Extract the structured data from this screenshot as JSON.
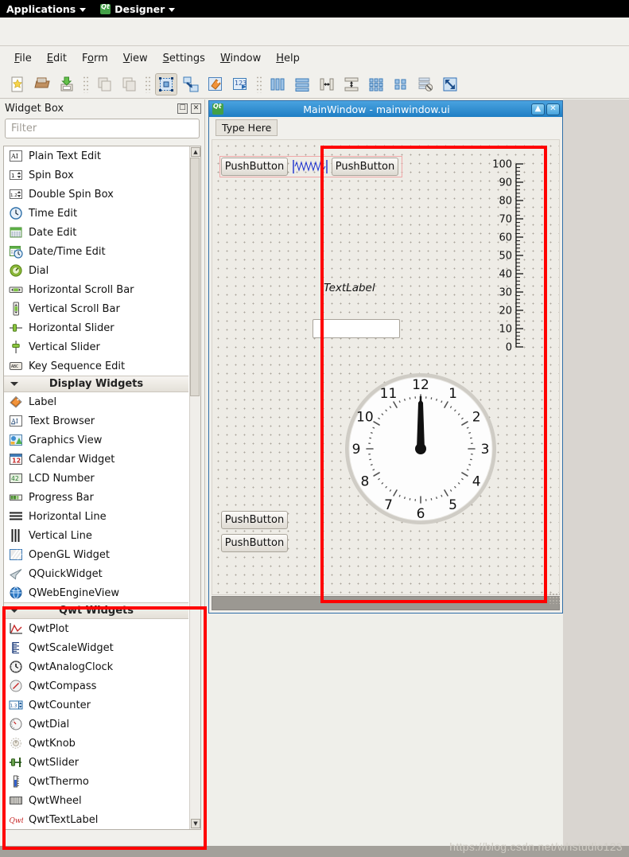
{
  "desktop": {
    "applications_label": "Applications",
    "app_label": "Designer",
    "qt_icon": "qt-logo-icon"
  },
  "menubar": {
    "items": [
      {
        "label": "File",
        "mnemonic": "F"
      },
      {
        "label": "Edit",
        "mnemonic": "E"
      },
      {
        "label": "Form",
        "mnemonic": "o"
      },
      {
        "label": "View",
        "mnemonic": "V"
      },
      {
        "label": "Settings",
        "mnemonic": "S"
      },
      {
        "label": "Window",
        "mnemonic": "W"
      },
      {
        "label": "Help",
        "mnemonic": "H"
      }
    ]
  },
  "toolbar": {
    "buttons": [
      {
        "name": "new-form-icon",
        "tip": "New"
      },
      {
        "name": "open-form-icon",
        "tip": "Open"
      },
      {
        "name": "save-form-icon",
        "tip": "Save"
      },
      {
        "name": "copy-icon",
        "tip": "Copy"
      },
      {
        "name": "paste-icon",
        "tip": "Paste"
      },
      {
        "name": "edit-widgets-icon",
        "tip": "Edit Widgets",
        "active": true
      },
      {
        "name": "edit-signals-slots-icon",
        "tip": "Edit Signals/Slots"
      },
      {
        "name": "edit-buddies-icon",
        "tip": "Edit Buddies"
      },
      {
        "name": "edit-tab-order-icon",
        "tip": "Edit Tab Order"
      },
      {
        "name": "layout-horizontally-icon",
        "tip": "Lay Out Horizontally"
      },
      {
        "name": "layout-vertically-icon",
        "tip": "Lay Out Vertically"
      },
      {
        "name": "layout-splitter-horizontal-icon",
        "tip": "Lay Out Horizontally in Splitter"
      },
      {
        "name": "layout-splitter-vertical-icon",
        "tip": "Lay Out Vertically in Splitter"
      },
      {
        "name": "layout-grid-icon",
        "tip": "Lay Out in a Grid"
      },
      {
        "name": "layout-form-icon",
        "tip": "Lay Out in a Form Layout"
      },
      {
        "name": "break-layout-icon",
        "tip": "Break Layout"
      },
      {
        "name": "adjust-size-icon",
        "tip": "Adjust Size"
      }
    ]
  },
  "widget_box": {
    "title": "Widget Box",
    "float_button": "float-icon",
    "close_button": "close-icon",
    "filter_placeholder": "Filter",
    "rows": [
      {
        "type": "item",
        "label": "Plain Text Edit",
        "icon": "plain-text-edit-icon"
      },
      {
        "type": "item",
        "label": "Spin Box",
        "icon": "spin-box-icon"
      },
      {
        "type": "item",
        "label": "Double Spin Box",
        "icon": "double-spin-box-icon"
      },
      {
        "type": "item",
        "label": "Time Edit",
        "icon": "time-edit-icon"
      },
      {
        "type": "item",
        "label": "Date Edit",
        "icon": "date-edit-icon"
      },
      {
        "type": "item",
        "label": "Date/Time Edit",
        "icon": "date-time-edit-icon"
      },
      {
        "type": "item",
        "label": "Dial",
        "icon": "dial-icon"
      },
      {
        "type": "item",
        "label": "Horizontal Scroll Bar",
        "icon": "horizontal-scroll-bar-icon"
      },
      {
        "type": "item",
        "label": "Vertical Scroll Bar",
        "icon": "vertical-scroll-bar-icon"
      },
      {
        "type": "item",
        "label": "Horizontal Slider",
        "icon": "horizontal-slider-icon"
      },
      {
        "type": "item",
        "label": "Vertical Slider",
        "icon": "vertical-slider-icon"
      },
      {
        "type": "item",
        "label": "Key Sequence Edit",
        "icon": "key-sequence-edit-icon"
      },
      {
        "type": "category",
        "label": "Display Widgets"
      },
      {
        "type": "item",
        "label": "Label",
        "icon": "label-icon"
      },
      {
        "type": "item",
        "label": "Text Browser",
        "icon": "text-browser-icon"
      },
      {
        "type": "item",
        "label": "Graphics View",
        "icon": "graphics-view-icon"
      },
      {
        "type": "item",
        "label": "Calendar Widget",
        "icon": "calendar-widget-icon"
      },
      {
        "type": "item",
        "label": "LCD Number",
        "icon": "lcd-number-icon"
      },
      {
        "type": "item",
        "label": "Progress Bar",
        "icon": "progress-bar-icon"
      },
      {
        "type": "item",
        "label": "Horizontal Line",
        "icon": "horizontal-line-icon"
      },
      {
        "type": "item",
        "label": "Vertical Line",
        "icon": "vertical-line-icon"
      },
      {
        "type": "item",
        "label": "OpenGL Widget",
        "icon": "opengl-widget-icon"
      },
      {
        "type": "item",
        "label": "QQuickWidget",
        "icon": "qquickwidget-icon"
      },
      {
        "type": "item",
        "label": "QWebEngineView",
        "icon": "qwebengineview-icon"
      },
      {
        "type": "category",
        "label": "Qwt Widgets"
      },
      {
        "type": "item",
        "label": "QwtPlot",
        "icon": "qwtplot-icon"
      },
      {
        "type": "item",
        "label": "QwtScaleWidget",
        "icon": "qwtscalewidget-icon"
      },
      {
        "type": "item",
        "label": "QwtAnalogClock",
        "icon": "qwtanalogclock-icon"
      },
      {
        "type": "item",
        "label": "QwtCompass",
        "icon": "qwtcompass-icon"
      },
      {
        "type": "item",
        "label": "QwtCounter",
        "icon": "qwtcounter-icon"
      },
      {
        "type": "item",
        "label": "QwtDial",
        "icon": "qwtdial-icon"
      },
      {
        "type": "item",
        "label": "QwtKnob",
        "icon": "qwtknob-icon"
      },
      {
        "type": "item",
        "label": "QwtSlider",
        "icon": "qwtslider-icon"
      },
      {
        "type": "item",
        "label": "QwtThermo",
        "icon": "qwtthermo-icon"
      },
      {
        "type": "item",
        "label": "QwtWheel",
        "icon": "qwtwheel-icon"
      },
      {
        "type": "item",
        "label": "QwtTextLabel",
        "icon": "qwttextlabel-icon"
      }
    ]
  },
  "form_window": {
    "title": "MainWindow - mainwindow.ui",
    "minimize_label": "▲",
    "close_label": "✕",
    "menu_placeholder": "Type Here",
    "widgets": {
      "pushbutton_top_left": "PushButton",
      "spacer": "horizontal-spacer",
      "pushbutton_top_right": "PushButton",
      "text_label": "TextLabel",
      "line_edit_value": "",
      "pushbutton_bottom_1": "PushButton",
      "pushbutton_bottom_2": "PushButton"
    },
    "scale_widget": {
      "name": "QwtScaleWidget",
      "ticks": [
        "100",
        "90",
        "80",
        "70",
        "60",
        "50",
        "40",
        "30",
        "20",
        "10",
        "0"
      ],
      "min": 0,
      "max": 100,
      "step": 10
    },
    "analog_clock": {
      "name": "QwtAnalogClock",
      "hour_numerals": [
        "12",
        "1",
        "2",
        "3",
        "4",
        "5",
        "6",
        "7",
        "8",
        "9",
        "10",
        "11"
      ],
      "hour_hand_deg": 0,
      "minute_hand_deg": 0,
      "time": "12:00"
    }
  },
  "annotations": {
    "highlight_color": "#ff0000",
    "boxes": [
      "qwt-widgets-section",
      "form-qwt-area"
    ]
  },
  "watermark": {
    "text": "https://blog.csdn.net/whstudio123"
  }
}
